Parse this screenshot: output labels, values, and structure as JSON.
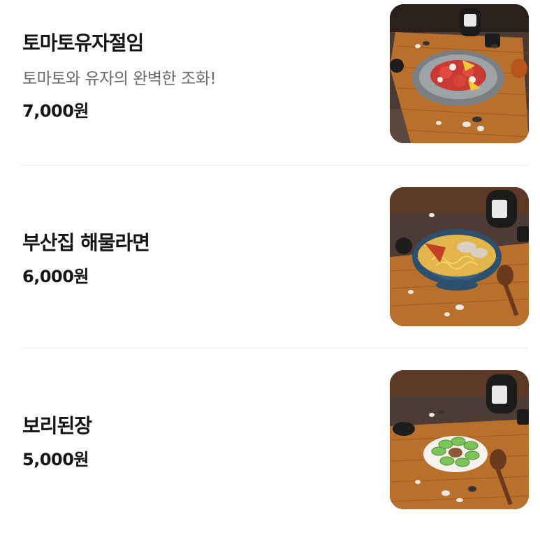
{
  "menu": {
    "items": [
      {
        "name": "토마토유자절임",
        "description": "토마토와 유자의 완벽한 조화!",
        "price": "7,000원",
        "image": "tomato-yuzu-salad-photo"
      },
      {
        "name": "부산집 해물라면",
        "price": "6,000원",
        "image": "seafood-ramen-photo"
      },
      {
        "name": "보리된장",
        "price": "5,000원",
        "image": "cucumber-doenjang-photo"
      }
    ]
  },
  "colors": {
    "title": "#151515",
    "description": "#6b6b6b",
    "divider": "#ececec",
    "table_wood": "#3b2c25",
    "placemat": "#b8702c"
  }
}
